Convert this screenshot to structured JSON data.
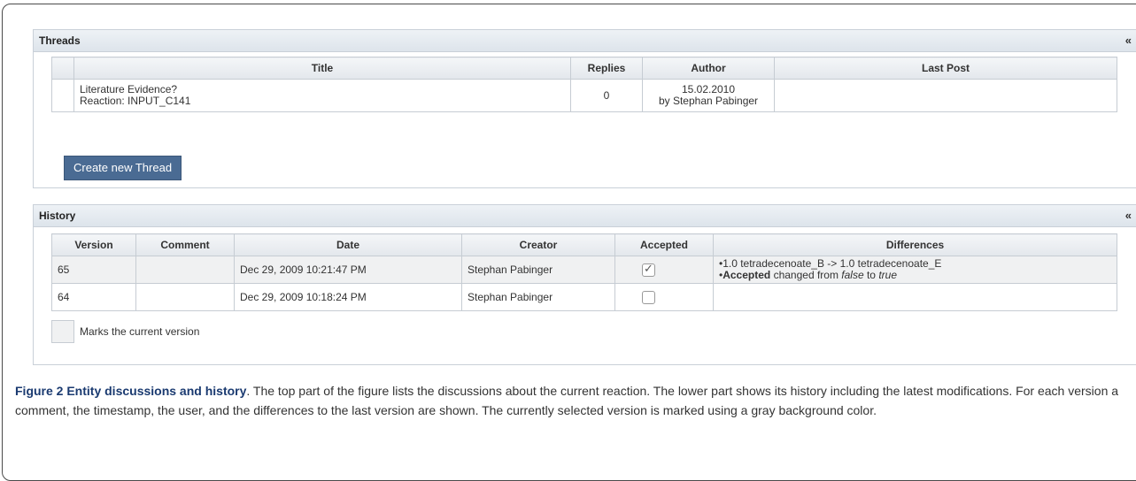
{
  "threads": {
    "title": "Threads",
    "collapse": "«",
    "columns": [
      "Title",
      "Replies",
      "Author",
      "Last Post"
    ],
    "rows": [
      {
        "title_line1": "Literature Evidence?",
        "title_line2": "Reaction: INPUT_C141",
        "replies": "0",
        "author_date": "15.02.2010",
        "author_by": "by Stephan Pabinger",
        "last_post": ""
      }
    ],
    "create_button": "Create new Thread"
  },
  "history": {
    "title": "History",
    "collapse": "«",
    "columns": [
      "Version",
      "Comment",
      "Date",
      "Creator",
      "Accepted",
      "Differences"
    ],
    "rows": [
      {
        "version": "65",
        "comment": "",
        "date": "Dec 29, 2009 10:21:47 PM",
        "creator": "Stephan Pabinger",
        "accepted": true,
        "diff1": "1.0 tetradecenoate_B -> 1.0 tetradecenoate_E",
        "diff2_bold": "Accepted",
        "diff2_mid": " changed from ",
        "diff2_from": "false",
        "diff2_to_word": " to ",
        "diff2_to": "true"
      },
      {
        "version": "64",
        "comment": "",
        "date": "Dec 29, 2009 10:18:24 PM",
        "creator": "Stephan Pabinger",
        "accepted": false
      }
    ],
    "legend": "Marks the current version"
  },
  "caption": {
    "label": "Figure 2 Entity discussions and history",
    "text": ". The top part of the figure lists the discussions about the current reaction. The lower part shows its history including the latest modifications. For each version a comment, the timestamp, the user, and the differences to the last version are shown. The currently selected version is marked using a gray background color."
  }
}
